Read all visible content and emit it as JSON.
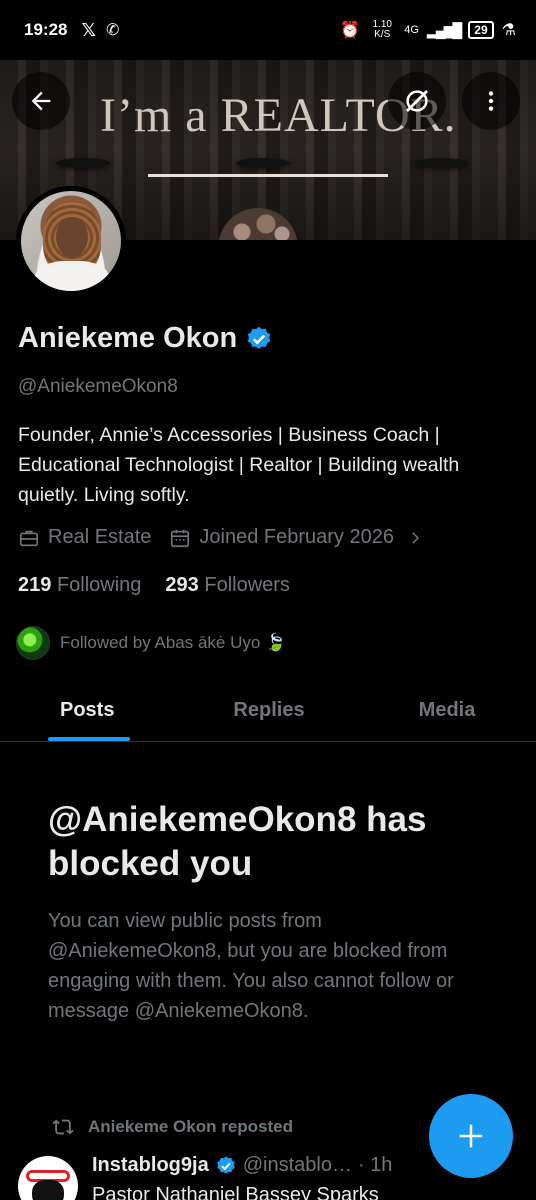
{
  "status_bar": {
    "time": "19:28",
    "network_speed": "1.10 K/S",
    "network_type": "4G",
    "battery": "29"
  },
  "banner": {
    "text": "I’m a REALTOR."
  },
  "profile": {
    "name": "Aniekeme Okon",
    "handle": "@AniekemeOkon8",
    "bio": "Founder, Annie’s Accessories | Business Coach | Educational Technologist | Realtor | Building wealth quietly. Living softly.",
    "category": "Real Estate",
    "joined": "Joined February 2026",
    "following_count": "219",
    "following_label": "Following",
    "followers_count": "293",
    "followers_label": "Followers",
    "followed_by": "Followed by Abas ākė Uyo 🍃"
  },
  "tabs": [
    {
      "label": "Posts",
      "active": true
    },
    {
      "label": "Replies",
      "active": false
    },
    {
      "label": "Media",
      "active": false
    }
  ],
  "blocked": {
    "title": "@AniekemeOkon8 has blocked you",
    "description": "You can view public posts from @AniekemeOkon8, but you are blocked from engaging with them. You also cannot follow or message @AniekemeOkon8."
  },
  "post": {
    "repost_label": "Aniekeme Okon reposted",
    "author_name": "Instablog9ja",
    "author_handle": "@instablo…",
    "time": "· 1h",
    "text": "Pastor Nathaniel Bassey Sparks"
  },
  "colors": {
    "accent": "#1d9bf0",
    "background": "#000000",
    "muted_text": "#71767b",
    "primary_text": "#e7e9ea"
  }
}
